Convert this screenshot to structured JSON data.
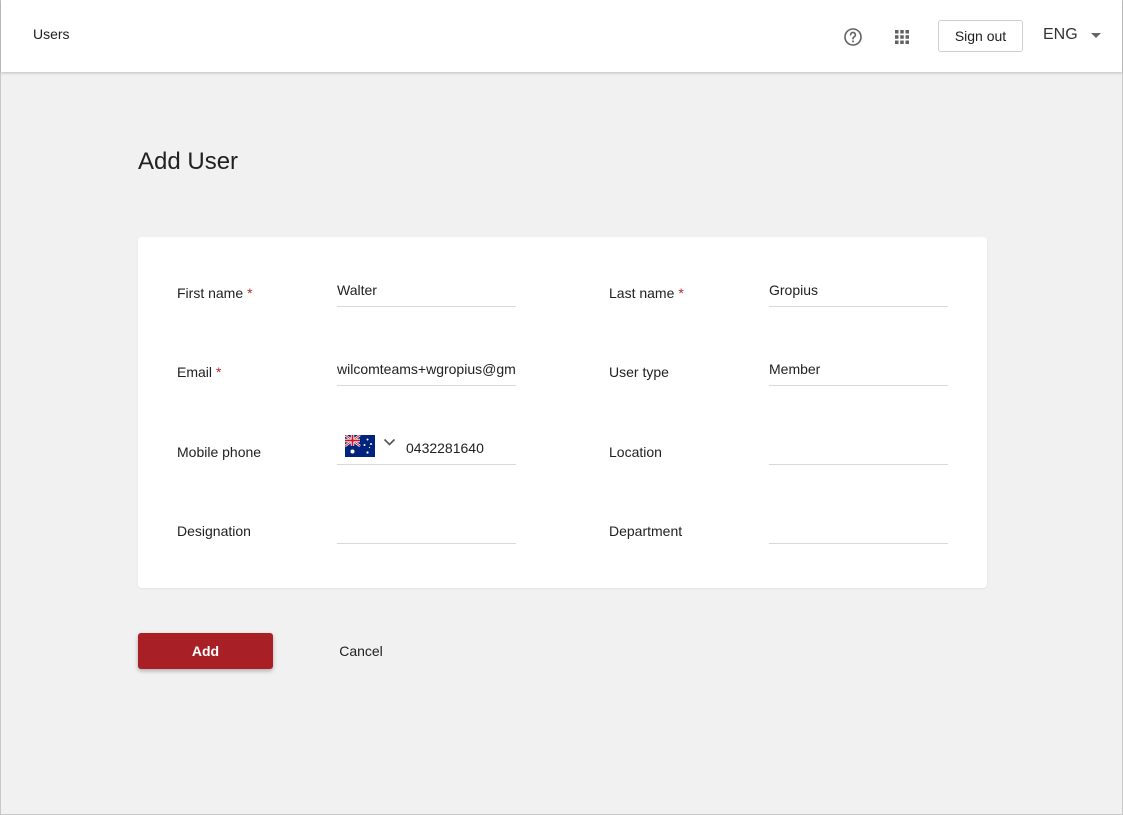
{
  "header": {
    "app_title": "Users",
    "help_icon": "help-circle-icon",
    "apps_icon": "apps-grid-icon",
    "sign_out_label": "Sign out",
    "language": "ENG"
  },
  "page": {
    "title": "Add User"
  },
  "form": {
    "required_marker": "*",
    "first_name": {
      "label": "First name",
      "value": "Walter",
      "required": true
    },
    "last_name": {
      "label": "Last name",
      "value": "Gropius",
      "required": true
    },
    "email": {
      "label": "Email",
      "value": "wilcomteams+wgropius@gm",
      "required": true
    },
    "user_type": {
      "label": "User type",
      "value": "Member"
    },
    "mobile_phone": {
      "label": "Mobile phone",
      "country_flag": "australia-flag-icon",
      "value": "0432281640"
    },
    "location": {
      "label": "Location",
      "value": ""
    },
    "designation": {
      "label": "Designation",
      "value": ""
    },
    "department": {
      "label": "Department",
      "value": ""
    }
  },
  "actions": {
    "add_label": "Add",
    "cancel_label": "Cancel"
  },
  "colors": {
    "primary": "#a81f26",
    "required": "#b3282d",
    "background": "#f1f1f1"
  }
}
